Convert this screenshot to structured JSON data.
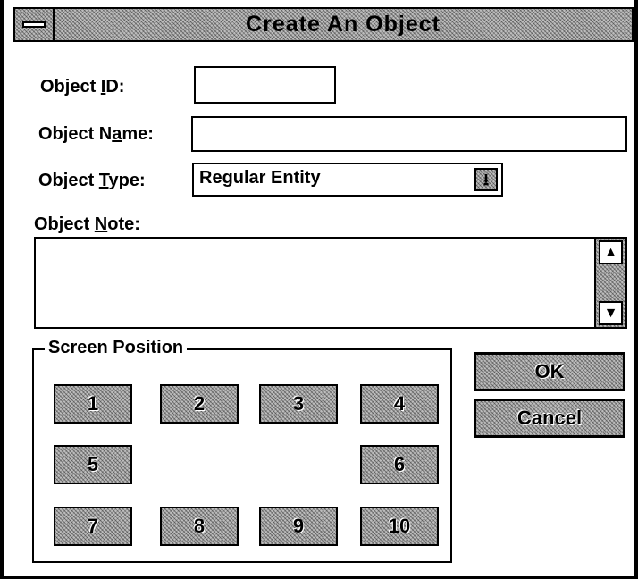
{
  "window": {
    "title": "Create An Object"
  },
  "form": {
    "object_id": {
      "label_pre": "Object ",
      "label_key": "I",
      "label_post": "D:",
      "value": ""
    },
    "object_name": {
      "label_pre": "Object N",
      "label_key": "a",
      "label_post": "me:",
      "value": ""
    },
    "object_type": {
      "label_pre": "Object ",
      "label_key": "T",
      "label_post": "ype:",
      "value": "Regular Entity"
    },
    "object_note": {
      "label_pre": "Object ",
      "label_key": "N",
      "label_post": "ote:",
      "value": ""
    }
  },
  "screen_position": {
    "label": "Screen Position",
    "buttons": [
      "1",
      "2",
      "3",
      "4",
      "5",
      "6",
      "7",
      "8",
      "9",
      "10"
    ]
  },
  "actions": {
    "ok_label": "OK",
    "cancel_label": "Cancel"
  },
  "icons": {
    "system_menu": "system-menu-icon",
    "dropdown": "dropdown-arrow-icon",
    "scroll_up": "scroll-up-arrow-icon",
    "scroll_down": "scroll-down-arrow-icon"
  },
  "colors": {
    "background": "#ffffff",
    "button_face": "#bdbdbd",
    "border": "#000000"
  }
}
